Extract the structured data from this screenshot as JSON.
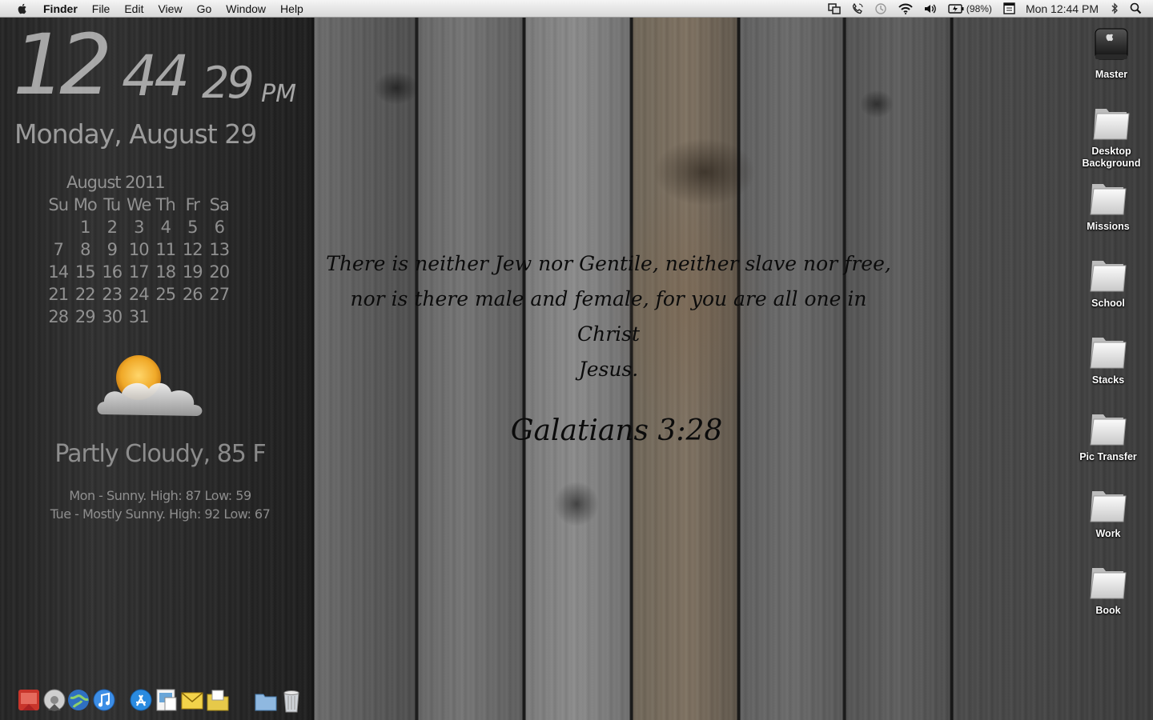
{
  "menubar": {
    "app_name": "Finder",
    "menus": [
      "File",
      "Edit",
      "View",
      "Go",
      "Window",
      "Help"
    ],
    "status_icons": [
      "mirror-display-icon",
      "phone-icon",
      "time-machine-icon",
      "wifi-icon",
      "volume-icon",
      "battery-icon",
      "calendar-icon",
      "bluetooth-icon",
      "spotlight-icon"
    ],
    "battery_text": "(98%)",
    "clock": "Mon 12:44 PM"
  },
  "clock_widget": {
    "hour": "12",
    "minute": "44",
    "second": "29",
    "ampm": "PM",
    "date": "Monday, August 29"
  },
  "calendar": {
    "title": "August 2011",
    "weekdays": [
      "Su",
      "Mo",
      "Tu",
      "We",
      "Th",
      "Fr",
      "Sa"
    ],
    "weeks": [
      [
        "",
        "1",
        "2",
        "3",
        "4",
        "5",
        "6"
      ],
      [
        "7",
        "8",
        "9",
        "10",
        "11",
        "12",
        "13"
      ],
      [
        "14",
        "15",
        "16",
        "17",
        "18",
        "19",
        "20"
      ],
      [
        "21",
        "22",
        "23",
        "24",
        "25",
        "26",
        "27"
      ],
      [
        "28",
        "29",
        "30",
        "31",
        "",
        "",
        ""
      ]
    ]
  },
  "weather": {
    "icon": "partly-cloudy-icon",
    "condition": "Partly Cloudy, 85 F",
    "forecast": [
      "Mon - Sunny. High: 87 Low: 59",
      "Tue - Mostly Sunny. High: 92 Low: 67"
    ]
  },
  "verse": {
    "lines": [
      "There is neither Jew nor Gentile, neither slave nor free,",
      "nor is there male and female, for you are all one in Christ",
      "Jesus."
    ],
    "reference": "Galatians 3:28"
  },
  "desktop_icons": [
    {
      "label": "Master",
      "type": "hard-drive"
    },
    {
      "label": "Desktop Background",
      "type": "folder"
    },
    {
      "label": "Missions",
      "type": "folder"
    },
    {
      "label": "School",
      "type": "folder"
    },
    {
      "label": "Stacks",
      "type": "folder"
    },
    {
      "label": "Pic Transfer",
      "type": "folder"
    },
    {
      "label": "Work",
      "type": "folder"
    },
    {
      "label": "Book",
      "type": "folder"
    }
  ],
  "dock": [
    "flashcard-app-icon",
    "disk-utility-icon",
    "network-globe-icon",
    "itunes-icon",
    "app-store-icon",
    "preview-icon",
    "mail-icon",
    "folder-stack-icon",
    "documents-folder-icon",
    "trash-icon"
  ],
  "colors": {
    "menubar": "#e6e6e6",
    "widget_text": "#d0d0d0",
    "verse_text": "#0b0b0b",
    "icon_label": "#ffffff"
  }
}
